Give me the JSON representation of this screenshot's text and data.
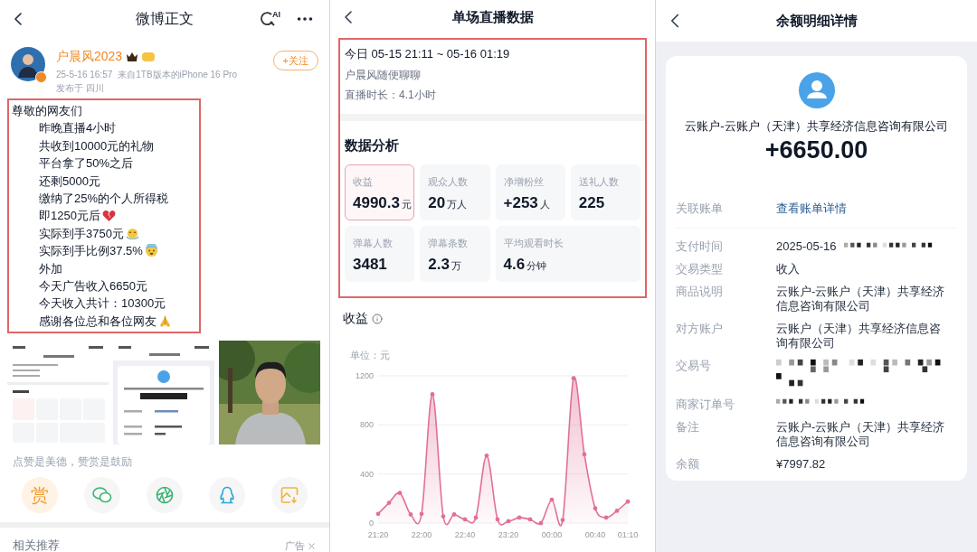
{
  "left": {
    "title": "微博正文",
    "ai_label": "AI",
    "post": {
      "author": "户晨风2023",
      "follow": "+关注",
      "time": "25-5-16 16:57",
      "source": "来自1TB版本的iPhone 16 Pro",
      "location": "发布于 四川",
      "greeting": "尊敬的网友们",
      "lines": [
        {
          "text": "昨晚直播4小时",
          "kind": "plain"
        },
        {
          "text": "共收到10000元的礼物",
          "kind": "plain"
        },
        {
          "text": "平台拿了50%之后",
          "kind": "plain"
        },
        {
          "text": "还剩5000元",
          "kind": "plain"
        },
        {
          "text": "缴纳了25%的个人所得税",
          "kind": "plain"
        },
        {
          "text": "即1250元后",
          "kind": "heartbreak"
        },
        {
          "text": "实际到手3750元",
          "kind": "tears"
        },
        {
          "text": "实际到手比例37.5%",
          "kind": "fear"
        },
        {
          "text": "外加",
          "kind": "plain"
        },
        {
          "text": "今天广告收入6650元",
          "kind": "plain"
        },
        {
          "text": "今天收入共计：10300元",
          "kind": "plain"
        },
        {
          "text": "感谢各位总和各位网友",
          "kind": "pray"
        }
      ]
    },
    "thumbnails": [
      {
        "kind": "stats_screenshot"
      },
      {
        "kind": "receipt_screenshot"
      },
      {
        "kind": "picture"
      }
    ],
    "reward_hint": "点赞是美德，赞赏是鼓励",
    "share": [
      {
        "kind": "reward",
        "label": "赏"
      },
      {
        "kind": "wechat"
      },
      {
        "kind": "moments"
      },
      {
        "kind": "qq"
      },
      {
        "kind": "save"
      }
    ],
    "related": "相关推荐",
    "ad": "广告"
  },
  "middle": {
    "title": "单场直播数据",
    "session": {
      "time": "今日 05-15 21:11 ~ 05-16 01:19",
      "name": "户晨风随便聊聊",
      "duration": "直播时长：4.1小时"
    },
    "section": "数据分析",
    "stats": [
      {
        "label": "收益",
        "value": "4990.3",
        "unit": "元",
        "selected": true,
        "kind": "normal"
      },
      {
        "label": "观众人数",
        "value": "20",
        "unit": "万人",
        "selected": false,
        "kind": "normal"
      },
      {
        "label": "净增粉丝",
        "value": "+253",
        "unit": "人",
        "selected": false,
        "kind": "normal"
      },
      {
        "label": "送礼人数",
        "value": "225",
        "selected": false,
        "kind": "normal"
      },
      {
        "label": "弹幕人数",
        "value": "3481",
        "selected": false,
        "kind": "normal"
      },
      {
        "label": "弹幕条数",
        "value": "2.3",
        "unit": "万",
        "selected": false,
        "kind": "normal"
      },
      {
        "label": "平均观看时长",
        "value": "4.6",
        "unit": "分钟",
        "selected": false,
        "kind": "wide"
      }
    ],
    "chart_data": {
      "type": "area",
      "title": "收益",
      "ylabel": "单位：元",
      "categories": [
        "21:20",
        null,
        null,
        null,
        "22:00",
        null,
        null,
        null,
        "22:40",
        null,
        null,
        null,
        "23:20",
        null,
        null,
        null,
        "00:00",
        null,
        null,
        null,
        "00:40",
        null,
        null,
        "01:10"
      ],
      "series": [
        {
          "color": "#e0709a",
          "values": [
            75,
            165,
            245,
            70,
            75,
            1050,
            55,
            70,
            30,
            45,
            550,
            30,
            15,
            45,
            30,
            0,
            190,
            25,
            1180,
            560,
            120,
            45,
            100,
            175
          ]
        }
      ],
      "ylim": [
        0,
        1200
      ],
      "yticks": [
        0,
        400,
        800,
        1200
      ]
    }
  },
  "right": {
    "title": "余额明细详情",
    "payer": "云账户-云账户（天津）共享经济信息咨询有限公司",
    "amount": "+6650.00",
    "linked": {
      "label": "关联账单",
      "value": "查看账单详情"
    },
    "details": [
      {
        "label": "支付时间",
        "value": "2025-05-16",
        "redacted": true
      },
      {
        "label": "交易类型",
        "value": "收入",
        "redacted": false
      },
      {
        "label": "商品说明",
        "value": "云账户-云账户（天津）共享经济信息咨询有限公司",
        "redacted": false
      },
      {
        "label": "对方账户",
        "value": "云账户（天津）共享经济信息咨询有限公司",
        "redacted": false
      },
      {
        "label": "交易号",
        "redacted": true
      },
      {
        "label": "商家订单号",
        "redacted": true
      },
      {
        "label": "备注",
        "value": "云账户-云账户（天津）共享经济信息咨询有限公司",
        "redacted": false
      },
      {
        "label": "余额",
        "value": "¥7997.82",
        "redacted": false
      }
    ]
  }
}
